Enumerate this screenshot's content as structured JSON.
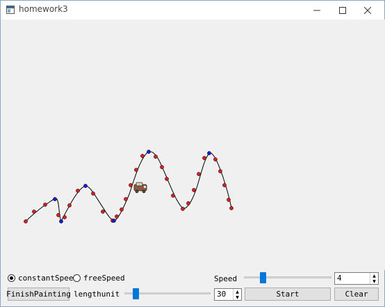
{
  "window": {
    "title": "homework3"
  },
  "controls": {
    "mode_constant": "constantSpeed",
    "mode_free": "freeSpeed",
    "mode_selected": "constantSpeed",
    "finish_button": "FinishPainting",
    "lengthunit_label": "lengthunit",
    "lengthunit_value": "30",
    "speed_label": "Speed",
    "speed_value": "4",
    "start_button": "Start",
    "clear_button": "Clear",
    "speed_slider_level": 0.18,
    "lengthunit_slider_level": 0.12
  },
  "icons": {
    "app": "app-window-icon",
    "minimize": "minimize-icon",
    "maximize": "maximize-icon",
    "close": "close-icon",
    "car": "car-icon"
  },
  "colors": {
    "point_red": "#d42020",
    "point_blue": "#1a1adb",
    "accent": "#0078d7"
  }
}
